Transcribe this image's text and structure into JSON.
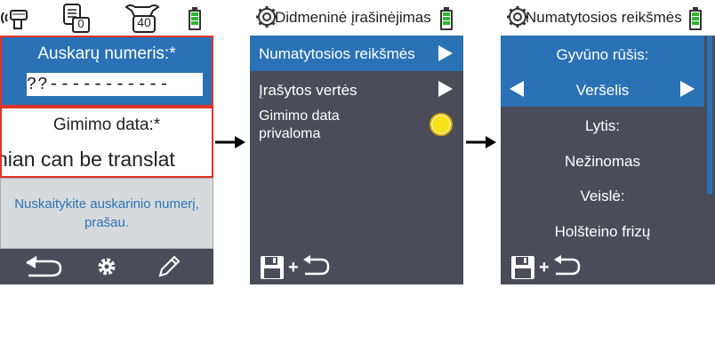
{
  "screen1": {
    "status_icons": [
      "rfid-reader-icon",
      "ear-tag-icon",
      "cattle-count-icon",
      "battery-icon"
    ],
    "ear_tag_counter": "0",
    "cattle_counter": "40",
    "ear_number_label": "Auskarų numeris:*",
    "ear_number_value": "??-----------",
    "birth_date_label": "Gimimo data:*",
    "translation_text": "nian can be translat",
    "message": "Nuskaitykite auskarinio numerį, prašau.",
    "bottom_icons": [
      "back-icon",
      "settings-icon",
      "edit-icon"
    ]
  },
  "screen2": {
    "title": "Didmeninė įrašinėjimas",
    "menu_items": [
      {
        "label": "Numatytosios reikšmės"
      },
      {
        "label": "Įrašytos vertės"
      }
    ],
    "toggle_label_line1": "Gimimo data",
    "toggle_label_line2": "privaloma",
    "bottom_icons": [
      "save-icon",
      "back-icon"
    ]
  },
  "screen3": {
    "title": "Numatytosios reikšmės",
    "species_label": "Gyvūno rūšis:",
    "species_value": "Veršelis",
    "sex_label": "Lytis:",
    "sex_value": "Nežinomas",
    "breed_label": "Veislė:",
    "breed_value": "Holšteino frizų",
    "bottom_icons": [
      "save-icon",
      "back-icon"
    ]
  },
  "colors": {
    "blue": "#2a72b5",
    "dark_panel": "#4a4d58",
    "red_border": "#e0332a",
    "message_bg": "#d7dadc",
    "message_text": "#2a72b5",
    "toggle_yellow": "#f7e21a"
  }
}
